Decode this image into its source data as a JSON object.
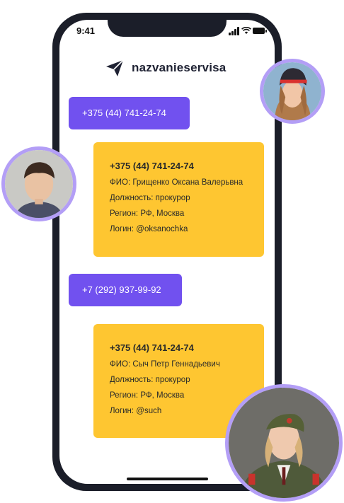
{
  "status_bar": {
    "time": "9:41"
  },
  "brand": {
    "name": "nazvanieservisa"
  },
  "queries": [
    {
      "text": "+375 (44) 741-24-74"
    },
    {
      "text": "+7 (292) 937-99-92"
    }
  ],
  "results": [
    {
      "phone": "+375 (44) 741-24-74",
      "fio": "ФИО: Грищенко Оксана Валерьвна",
      "position": "Должность: прокурор",
      "region": "Регион: РФ, Москва",
      "login": "Логин: @oksanochka"
    },
    {
      "phone": "+375 (44) 741-24-74",
      "fio": "ФИО: Сыч Петр Геннадьевич",
      "position": "Должность: прокурор",
      "region": "Регион: РФ, Москва",
      "login": "Логин: @such"
    }
  ],
  "colors": {
    "accent": "#7151ef",
    "card": "#fec631",
    "frame": "#1b1e29",
    "avatar_ring": "#b39ef6"
  }
}
